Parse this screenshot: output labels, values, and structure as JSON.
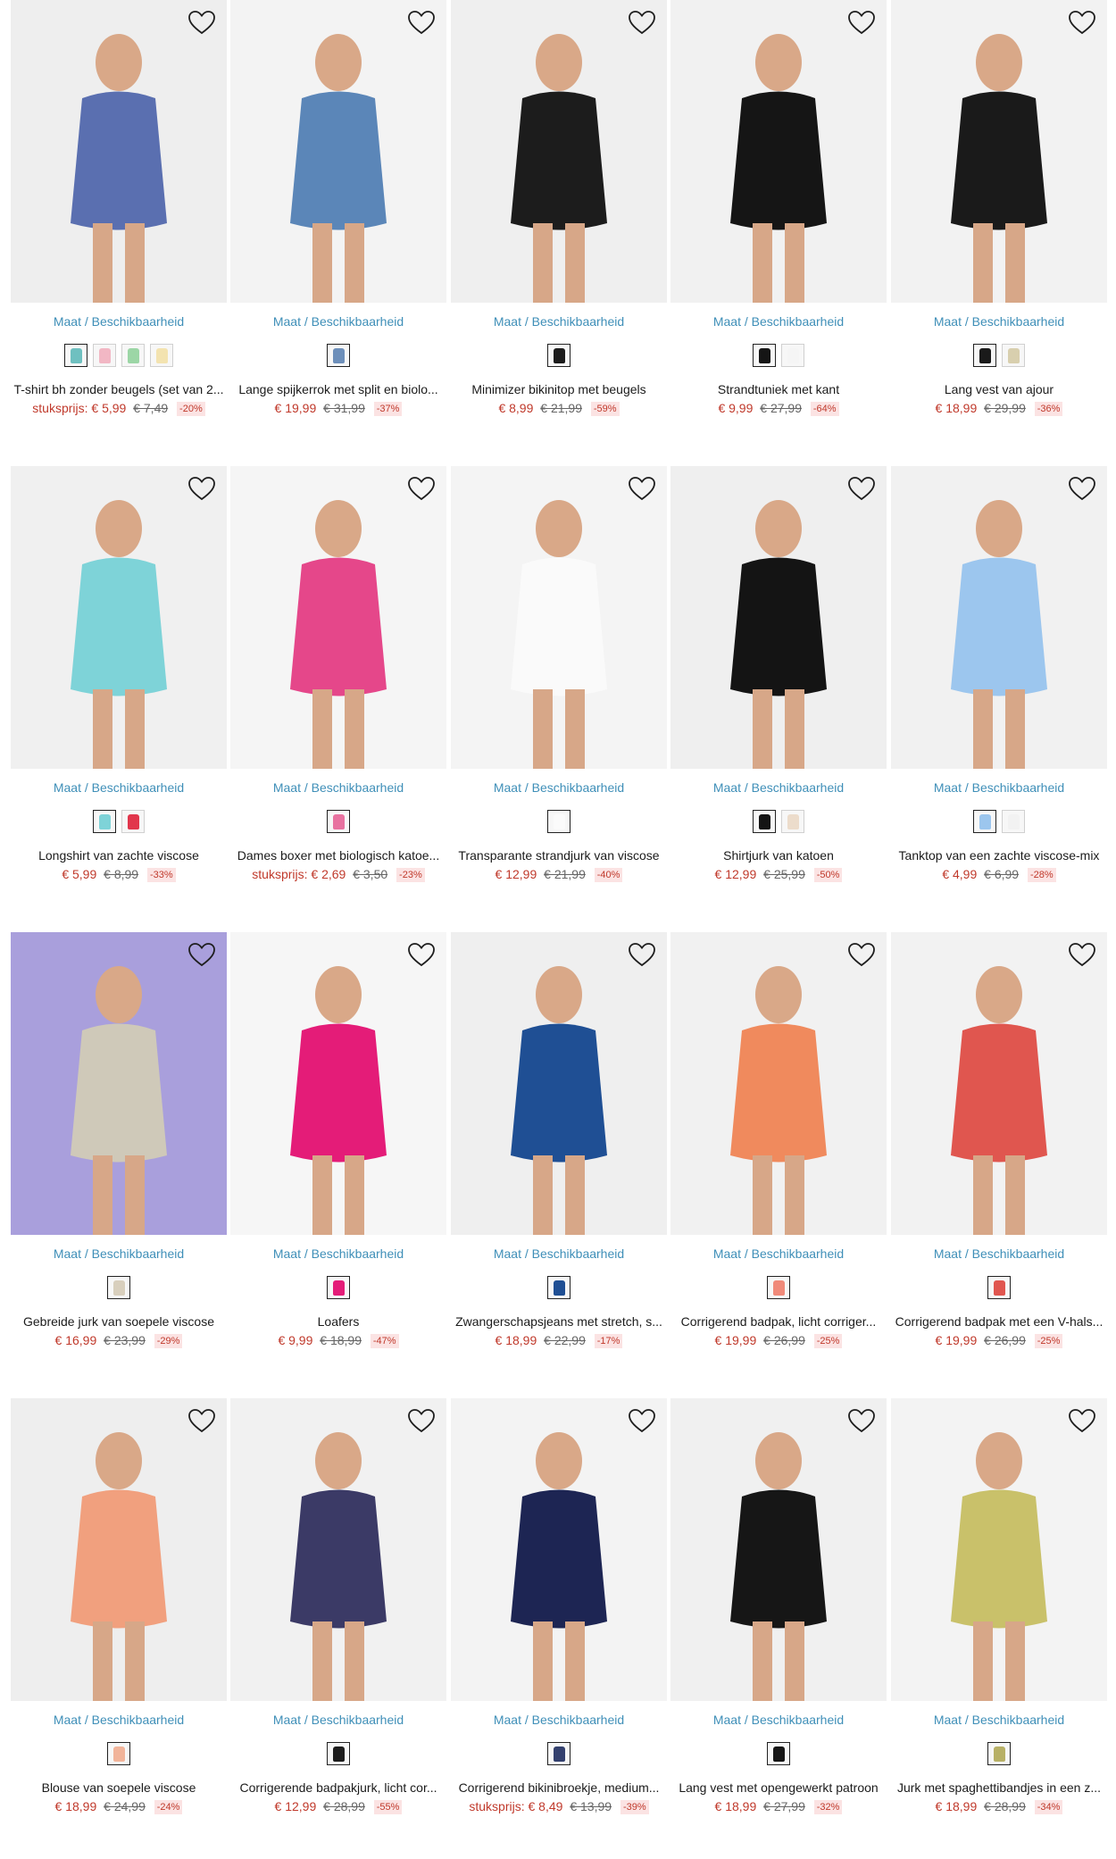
{
  "size_label": "Maat / Beschikbaarheid",
  "products": [
    {
      "title": "T-shirt bh zonder beugels (set van 2...",
      "prefix": "stuksprijs:",
      "price": "€ 5,99",
      "was": "€ 7,49",
      "discount": "-20%",
      "bg": "#eeeeee",
      "accent": "#5a6fb0",
      "swatches": [
        "#6fc0c0",
        "#f2b7c4",
        "#9cd6a6",
        "#f3e3b0"
      ]
    },
    {
      "title": "Lange spijkerrok met split en biolo...",
      "prefix": "",
      "price": "€ 19,99",
      "was": "€ 31,99",
      "discount": "-37%",
      "bg": "#f3f3f3",
      "accent": "#5b86b8",
      "swatches": [
        "#6d8fba"
      ]
    },
    {
      "title": "Minimizer bikinitop met beugels",
      "prefix": "",
      "price": "€ 8,99",
      "was": "€ 21,99",
      "discount": "-59%",
      "bg": "#efefef",
      "accent": "#1c1c1c",
      "swatches": [
        "#1c1c1c"
      ]
    },
    {
      "title": "Strandtuniek met kant",
      "prefix": "",
      "price": "€ 9,99",
      "was": "€ 27,99",
      "discount": "-64%",
      "bg": "#f1f1f1",
      "accent": "#151515",
      "swatches": [
        "#151515",
        "#f5f5f5"
      ]
    },
    {
      "title": "Lang vest van ajour",
      "prefix": "",
      "price": "€ 18,99",
      "was": "€ 29,99",
      "discount": "-36%",
      "bg": "#f2f2f2",
      "accent": "#1a1a1a",
      "swatches": [
        "#1a1a1a",
        "#d8cfae"
      ]
    },
    {
      "title": "Longshirt van zachte viscose",
      "prefix": "",
      "price": "€ 5,99",
      "was": "€ 8,99",
      "discount": "-33%",
      "bg": "#f0f0f0",
      "accent": "#7ed3d8",
      "swatches": [
        "#7ed3d8",
        "#e1364c"
      ]
    },
    {
      "title": "Dames boxer met biologisch katoe...",
      "prefix": "stuksprijs:",
      "price": "€ 2,69",
      "was": "€ 3,50",
      "discount": "-23%",
      "bg": "#f5f5f5",
      "accent": "#e5478a",
      "swatches": [
        "#e872a0"
      ]
    },
    {
      "title": "Transparante strandjurk van viscose",
      "prefix": "",
      "price": "€ 12,99",
      "was": "€ 21,99",
      "discount": "-40%",
      "bg": "#f4f4f4",
      "accent": "#fafafa",
      "swatches": [
        "#fbfbfb"
      ]
    },
    {
      "title": "Shirtjurk van katoen",
      "prefix": "",
      "price": "€ 12,99",
      "was": "€ 25,99",
      "discount": "-50%",
      "bg": "#efefef",
      "accent": "#141414",
      "swatches": [
        "#141414",
        "#ecdccb"
      ]
    },
    {
      "title": "Tanktop van een zachte viscose-mix",
      "prefix": "",
      "price": "€ 4,99",
      "was": "€ 6,99",
      "discount": "-28%",
      "bg": "#f1f1f1",
      "accent": "#9cc6ee",
      "swatches": [
        "#9cc6ee",
        "#f2f2f2"
      ]
    },
    {
      "title": "Gebreide jurk van soepele viscose",
      "prefix": "",
      "price": "€ 16,99",
      "was": "€ 23,99",
      "discount": "-29%",
      "bg": "#a99fdc",
      "accent": "#cfc9b9",
      "swatches": [
        "#d8cfbd"
      ]
    },
    {
      "title": "Loafers",
      "prefix": "",
      "price": "€ 9,99",
      "was": "€ 18,99",
      "discount": "-47%",
      "bg": "#f6f6f6",
      "accent": "#e41c78",
      "swatches": [
        "#e41c78"
      ]
    },
    {
      "title": "Zwangerschapsjeans met stretch, s...",
      "prefix": "",
      "price": "€ 18,99",
      "was": "€ 22,99",
      "discount": "-17%",
      "bg": "#efefef",
      "accent": "#1f4f94",
      "swatches": [
        "#1f4f94"
      ]
    },
    {
      "title": "Corrigerend badpak, licht corriger...",
      "prefix": "",
      "price": "€ 19,99",
      "was": "€ 26,99",
      "discount": "-25%",
      "bg": "#f1f1f1",
      "accent": "#f08a5d",
      "swatches": [
        "#f08a7a"
      ]
    },
    {
      "title": "Corrigerend badpak met een V-hals...",
      "prefix": "",
      "price": "€ 19,99",
      "was": "€ 26,99",
      "discount": "-25%",
      "bg": "#f2f2f2",
      "accent": "#e0564f",
      "swatches": [
        "#e0564f"
      ]
    },
    {
      "title": "Blouse van soepele viscose",
      "prefix": "",
      "price": "€ 18,99",
      "was": "€ 24,99",
      "discount": "-24%",
      "bg": "#eeeeee",
      "accent": "#f1a07e",
      "swatches": [
        "#f1b49a"
      ]
    },
    {
      "title": "Corrigerende badpakjurk, licht cor...",
      "prefix": "",
      "price": "€ 12,99",
      "was": "€ 28,99",
      "discount": "-55%",
      "bg": "#f1f1f1",
      "accent": "#3b3a66",
      "swatches": [
        "#1d1d1d"
      ]
    },
    {
      "title": "Corrigerend bikinibroekje, medium...",
      "prefix": "stuksprijs:",
      "price": "€ 8,49",
      "was": "€ 13,99",
      "discount": "-39%",
      "bg": "#f3f3f3",
      "accent": "#1d2553",
      "swatches": [
        "#33406e"
      ]
    },
    {
      "title": "Lang vest met opengewerkt patroon",
      "prefix": "",
      "price": "€ 18,99",
      "was": "€ 27,99",
      "discount": "-32%",
      "bg": "#f0f0f0",
      "accent": "#161616",
      "swatches": [
        "#161616"
      ]
    },
    {
      "title": "Jurk met spaghettibandjes in een z...",
      "prefix": "",
      "price": "€ 18,99",
      "was": "€ 28,99",
      "discount": "-34%",
      "bg": "#f3f3f3",
      "accent": "#c9c16a",
      "swatches": [
        "#b7b066"
      ]
    }
  ]
}
